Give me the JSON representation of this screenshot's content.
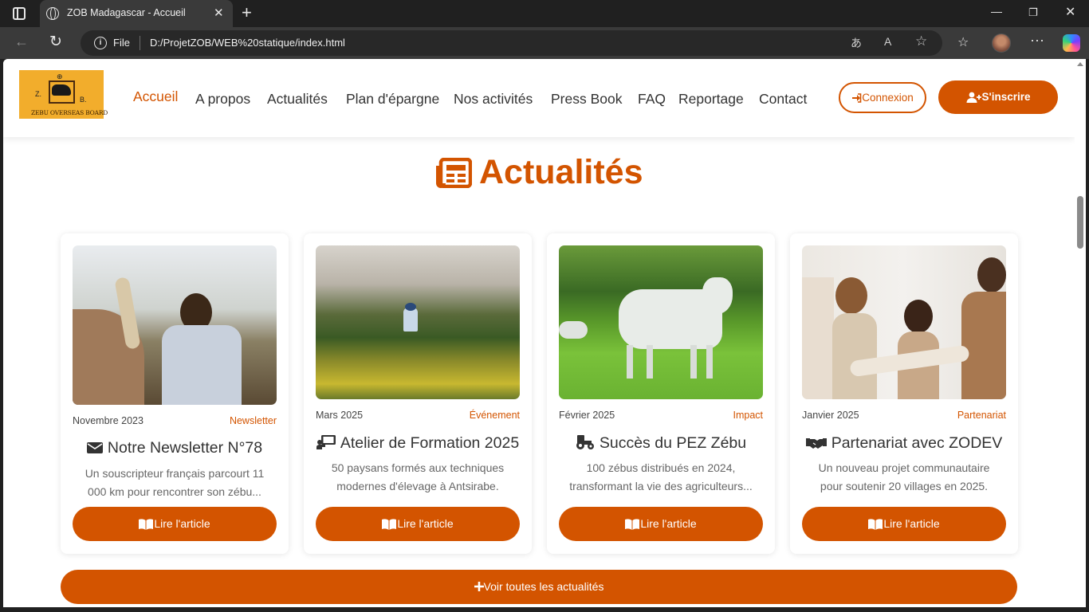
{
  "browser": {
    "tab_title": "ZOB Madagascar - Accueil",
    "file_label": "File",
    "url": "D:/ProjetZOB/WEB%20statique/index.html"
  },
  "site": {
    "logo_letters": {
      "left": "Z.",
      "right": "B."
    },
    "logo_text": "ZEBU OVERSEAS BOARD",
    "nav": [
      "Accueil",
      "A propos",
      "Actualités",
      "Plan d'épargne",
      "Nos activités",
      "Press Book",
      "FAQ",
      "Reportage",
      "Contact"
    ],
    "login_label": "Connexion",
    "signup_label": "S'inscrire"
  },
  "news": {
    "title": "Actualités",
    "cards": [
      {
        "date": "Novembre 2023",
        "category": "Newsletter",
        "title": "Notre Newsletter N°78",
        "description": "Un souscripteur français parcourt 11 000 km pour rencontrer son zébu...",
        "button": "Lire l'article",
        "icon": "envelope-icon"
      },
      {
        "date": "Mars 2025",
        "category": "Événement",
        "title": "Atelier de Formation 2025",
        "description": "50 paysans formés aux techniques modernes d'élevage à Antsirabe.",
        "button": "Lire l'article",
        "icon": "teacher-icon"
      },
      {
        "date": "Février 2025",
        "category": "Impact",
        "title": "Succès du PEZ Zébu",
        "description": "100 zébus distribués en 2024, transformant la vie des agriculteurs...",
        "button": "Lire l'article",
        "icon": "tractor-icon"
      },
      {
        "date": "Janvier 2025",
        "category": "Partenariat",
        "title": "Partenariat avec ZODEV",
        "description": "Un nouveau projet communautaire pour soutenir 20 villages en 2025.",
        "button": "Lire l'article",
        "icon": "handshake-icon"
      }
    ],
    "all_label": "Voir toutes les actualités"
  },
  "colors": {
    "accent": "#d35400"
  }
}
